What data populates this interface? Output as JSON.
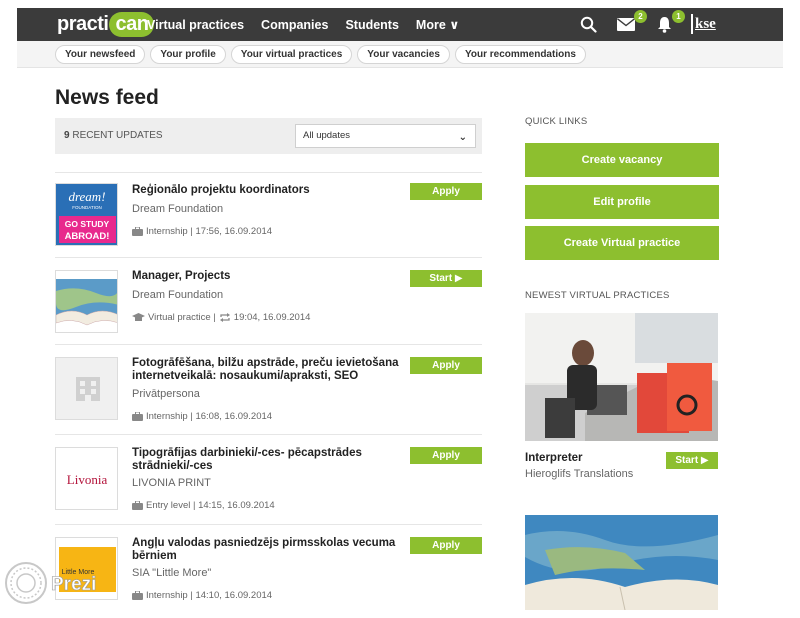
{
  "nav": {
    "logo_a": "practi",
    "logo_b": "can",
    "links": [
      "Virtual practices",
      "Companies",
      "Students",
      "More ∨"
    ],
    "messages_badge": "2",
    "notifications_badge": "1",
    "user_logo": "kse"
  },
  "subnav": {
    "pills": [
      "Your newsfeed",
      "Your profile",
      "Your virtual practices",
      "Your vacancies",
      "Your recommendations"
    ]
  },
  "feed": {
    "heading": "News feed",
    "count": "9",
    "count_label": "RECENT UPDATES",
    "filter_value": "All updates",
    "items": [
      {
        "title": "Reģionālo projektu koordinators",
        "company": "Dream Foundation",
        "meta": "Internship | 17:56, 16.09.2014",
        "action": "Apply",
        "thumb_top": "dream!",
        "thumb_small": "FOUNDATION",
        "thumb_bottom": "GO STUDY ABROAD!"
      },
      {
        "title": "Manager, Projects",
        "company": "Dream Foundation",
        "meta_a": "Virtual practice |",
        "meta_b": "19:04, 16.09.2014",
        "action": "Start ▶"
      },
      {
        "title": "Fotogrāfēšana, bilžu apstrāde, preču ievietošana internetveikalā: nosaukumi/apraksti, SEO",
        "company": "Privātpersona",
        "meta": "Internship | 16:08, 16.09.2014",
        "action": "Apply"
      },
      {
        "title": "Tipogrāfijas darbinieki/-ces- pēcapstrādes strādnieki/-ces",
        "company": "LIVONIA PRINT",
        "meta": "Entry level | 14:15, 16.09.2014",
        "action": "Apply",
        "thumb_text": "Livonia"
      },
      {
        "title": "Angļu valodas pasniedzējs pirmsskolas vecuma bērniem",
        "company": "SIA \"Little More\"",
        "meta": "Internship | 14:10, 16.09.2014",
        "action": "Apply",
        "thumb_text": "Little More"
      }
    ]
  },
  "sidebar": {
    "quick_links_heading": "QUICK LINKS",
    "quick_links": [
      "Create vacancy",
      "Edit profile",
      "Create Virtual practice"
    ],
    "newest_heading": "NEWEST VIRTUAL PRACTICES",
    "vp": {
      "title": "Interpreter",
      "company": "Hieroglifs Translations",
      "action": "Start ▶"
    }
  },
  "watermark": "Prezi",
  "colors": {
    "accent": "#8dbf2f",
    "topbar": "#3b3b3b"
  }
}
